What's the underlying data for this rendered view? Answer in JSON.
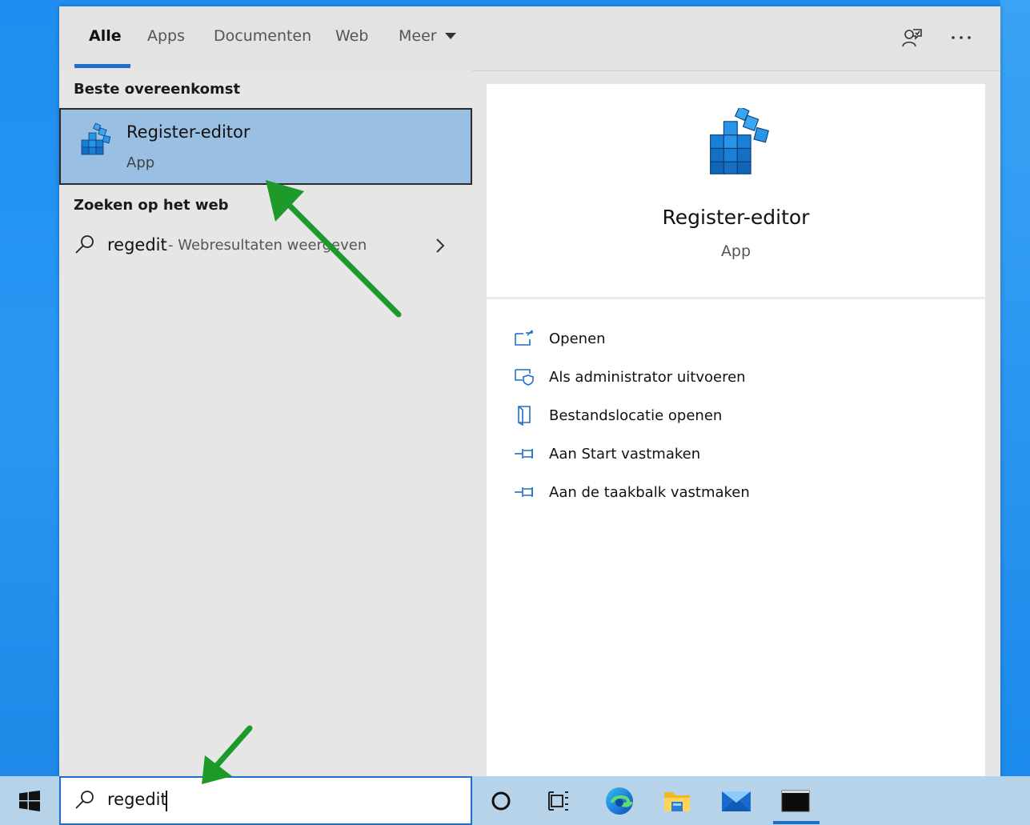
{
  "tabs": [
    {
      "label": "Alle"
    },
    {
      "label": "Apps"
    },
    {
      "label": "Documenten"
    },
    {
      "label": "Web"
    },
    {
      "label": "Meer"
    }
  ],
  "header_icons": [
    "feedback-icon",
    "more-options-icon"
  ],
  "best_match": {
    "section_title": "Beste overeenkomst",
    "title": "Register-editor",
    "subtitle": "App"
  },
  "web": {
    "section_title": "Zoeken op het web",
    "query": "regedit",
    "suffix": "- Webresultaten weergeven"
  },
  "preview": {
    "title": "Register-editor",
    "subtitle": "App",
    "actions": [
      {
        "label": "Openen",
        "icon": "open-icon"
      },
      {
        "label": "Als administrator uitvoeren",
        "icon": "admin-shield-icon"
      },
      {
        "label": "Bestandslocatie openen",
        "icon": "file-location-icon"
      },
      {
        "label": "Aan Start vastmaken",
        "icon": "pin-start-icon"
      },
      {
        "label": "Aan de taakbalk vastmaken",
        "icon": "pin-taskbar-icon"
      }
    ]
  },
  "search": {
    "value": "regedit"
  },
  "taskbar": {
    "icons": [
      "start-icon",
      "cortana-icon",
      "task-view-icon",
      "edge-icon",
      "file-explorer-icon",
      "mail-icon",
      "terminal-icon"
    ]
  },
  "colors": {
    "accent": "#1f6fc8",
    "selection": "#99bfe3",
    "arrow": "#1e9a2a",
    "desktop": "#1f8ef0"
  }
}
